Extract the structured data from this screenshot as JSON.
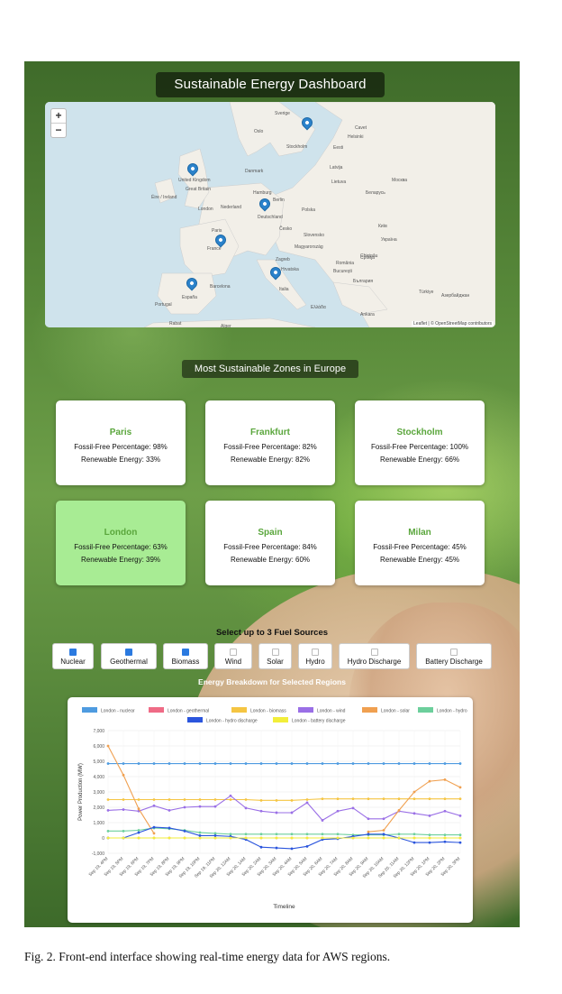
{
  "dashboard_title": "Sustainable Energy Dashboard",
  "map": {
    "zoom_in": "+",
    "zoom_out": "−",
    "labels": [
      "Sverige",
      "Oslo",
      "Stockholm",
      "Helsinki",
      "Eesti",
      "Latvija",
      "Lietuva",
      "Danmark",
      "United Kingdom",
      "Great Britain",
      "Éire / Ireland",
      "London",
      "Nederland",
      "Hamburg",
      "Berlin",
      "Polska",
      "Deutschland",
      "Česko",
      "Paris",
      "France",
      "Slovensko",
      "Magyarország",
      "Zagreb",
      "România",
      "Bucureşti",
      "Hrvatska",
      "Србија",
      "България",
      "Italia",
      "Barcelona",
      "España",
      "Portugal",
      "Rabat",
      "Alger",
      "Ελλάδα",
      "Ankara",
      "Türkiye",
      "Беларусь",
      "Москва",
      "Україна",
      "Київ",
      "Chişinău",
      "Азербайджан",
      "Cavet"
    ],
    "attribution": "Leaflet | © OpenStreetMap contributors",
    "pins": [
      "Stockholm",
      "London",
      "Frankfurt",
      "Paris",
      "Spain",
      "Milan"
    ]
  },
  "zones_title": "Most Sustainable Zones in Europe",
  "zones": [
    {
      "name": "Paris",
      "fossil": "Fossil-Free Percentage: 98%",
      "renew": "Renewable Energy: 33%",
      "selected": false
    },
    {
      "name": "Frankfurt",
      "fossil": "Fossil-Free Percentage: 82%",
      "renew": "Renewable Energy: 82%",
      "selected": false
    },
    {
      "name": "Stockholm",
      "fossil": "Fossil-Free Percentage: 100%",
      "renew": "Renewable Energy: 66%",
      "selected": false
    },
    {
      "name": "London",
      "fossil": "Fossil-Free Percentage: 63%",
      "renew": "Renewable Energy: 39%",
      "selected": true
    },
    {
      "name": "Spain",
      "fossil": "Fossil-Free Percentage: 84%",
      "renew": "Renewable Energy: 60%",
      "selected": false
    },
    {
      "name": "Milan",
      "fossil": "Fossil-Free Percentage: 45%",
      "renew": "Renewable Energy: 45%",
      "selected": false
    }
  ],
  "fuel_header": "Select up to 3 Fuel Sources",
  "fuels": [
    {
      "label": "Nuclear",
      "checked": true
    },
    {
      "label": "Geothermal",
      "checked": true
    },
    {
      "label": "Biomass",
      "checked": true
    },
    {
      "label": "Wind",
      "checked": false
    },
    {
      "label": "Solar",
      "checked": false
    },
    {
      "label": "Hydro",
      "checked": false
    },
    {
      "label": "Hydro Discharge",
      "checked": false
    },
    {
      "label": "Battery Discharge",
      "checked": false
    }
  ],
  "breakdown_title": "Energy Breakdown for Selected Regions",
  "chart_data": {
    "type": "line",
    "xlabel": "Timeline",
    "ylabel": "Power Production (MW)",
    "ylim": [
      -1000,
      7000
    ],
    "yticks": [
      "-1,000",
      "0",
      "1,000",
      "2,000",
      "3,000",
      "4,000",
      "5,000",
      "6,000",
      "7,000"
    ],
    "categories": [
      "Sep 19, 4PM",
      "Sep 19, 5PM",
      "Sep 19, 6PM",
      "Sep 19, 7PM",
      "Sep 19, 8PM",
      "Sep 19, 9PM",
      "Sep 19, 10PM",
      "Sep 19, 11PM",
      "Sep 20, 12AM",
      "Sep 20, 1AM",
      "Sep 20, 2AM",
      "Sep 20, 3AM",
      "Sep 20, 4AM",
      "Sep 20, 5AM",
      "Sep 20, 6AM",
      "Sep 20, 7AM",
      "Sep 20, 8AM",
      "Sep 20, 9AM",
      "Sep 20, 10AM",
      "Sep 20, 11AM",
      "Sep 20, 12PM",
      "Sep 20, 1PM",
      "Sep 20, 2PM",
      "Sep 20, 3PM"
    ],
    "legend_position": "top",
    "grid": true,
    "series": [
      {
        "name": "London - nuclear",
        "color": "#4e9be0",
        "values": [
          4850,
          4850,
          4850,
          4850,
          4850,
          4850,
          4850,
          4850,
          4850,
          4850,
          4850,
          4850,
          4850,
          4850,
          4850,
          4850,
          4850,
          4850,
          4850,
          4850,
          4850,
          4850,
          4850,
          4850
        ]
      },
      {
        "name": "London - geothermal",
        "color": "#ef6b86",
        "values": [
          0,
          0,
          0,
          0,
          0,
          0,
          0,
          0,
          0,
          0,
          0,
          0,
          0,
          0,
          0,
          0,
          0,
          0,
          0,
          0,
          0,
          0,
          0,
          0
        ]
      },
      {
        "name": "London - biomass",
        "color": "#f5c542",
        "values": [
          2500,
          2500,
          2500,
          2500,
          2500,
          2500,
          2500,
          2500,
          2500,
          2500,
          2450,
          2450,
          2450,
          2500,
          2550,
          2550,
          2550,
          2550,
          2550,
          2550,
          2550,
          2550,
          2550,
          2550
        ]
      },
      {
        "name": "London - wind",
        "color": "#9a6fe6",
        "values": [
          1800,
          1850,
          1750,
          2100,
          1800,
          2000,
          2050,
          2050,
          2750,
          1950,
          1750,
          1650,
          1650,
          2300,
          1150,
          1750,
          1950,
          1250,
          1250,
          1750,
          1600,
          1450,
          1750,
          1450
        ]
      },
      {
        "name": "London - solar",
        "color": "#f0a050",
        "values": [
          6000,
          4100,
          1900,
          300,
          null,
          null,
          null,
          null,
          null,
          null,
          null,
          null,
          null,
          null,
          null,
          null,
          null,
          400,
          500,
          1800,
          3000,
          3700,
          3800,
          3300
        ]
      },
      {
        "name": "London - hydro",
        "color": "#6ccf9c",
        "values": [
          450,
          450,
          500,
          650,
          600,
          500,
          350,
          300,
          250,
          250,
          250,
          250,
          250,
          250,
          250,
          250,
          200,
          200,
          200,
          250,
          250,
          200,
          200,
          200
        ]
      },
      {
        "name": "London - hydro discharge",
        "color": "#2b55dd",
        "values": [
          0,
          0,
          350,
          700,
          650,
          450,
          150,
          150,
          100,
          -100,
          -600,
          -650,
          -700,
          -550,
          -100,
          -50,
          100,
          250,
          250,
          0,
          -300,
          -300,
          -250,
          -300
        ]
      },
      {
        "name": "London - battery discharge",
        "color": "#f2ee3a",
        "values": [
          0,
          0,
          0,
          0,
          0,
          0,
          0,
          0,
          0,
          0,
          0,
          0,
          0,
          0,
          0,
          0,
          0,
          0,
          0,
          0,
          0,
          0,
          0,
          0
        ]
      }
    ]
  },
  "caption": "Fig. 2.  Front-end interface showing real-time energy data for AWS regions."
}
